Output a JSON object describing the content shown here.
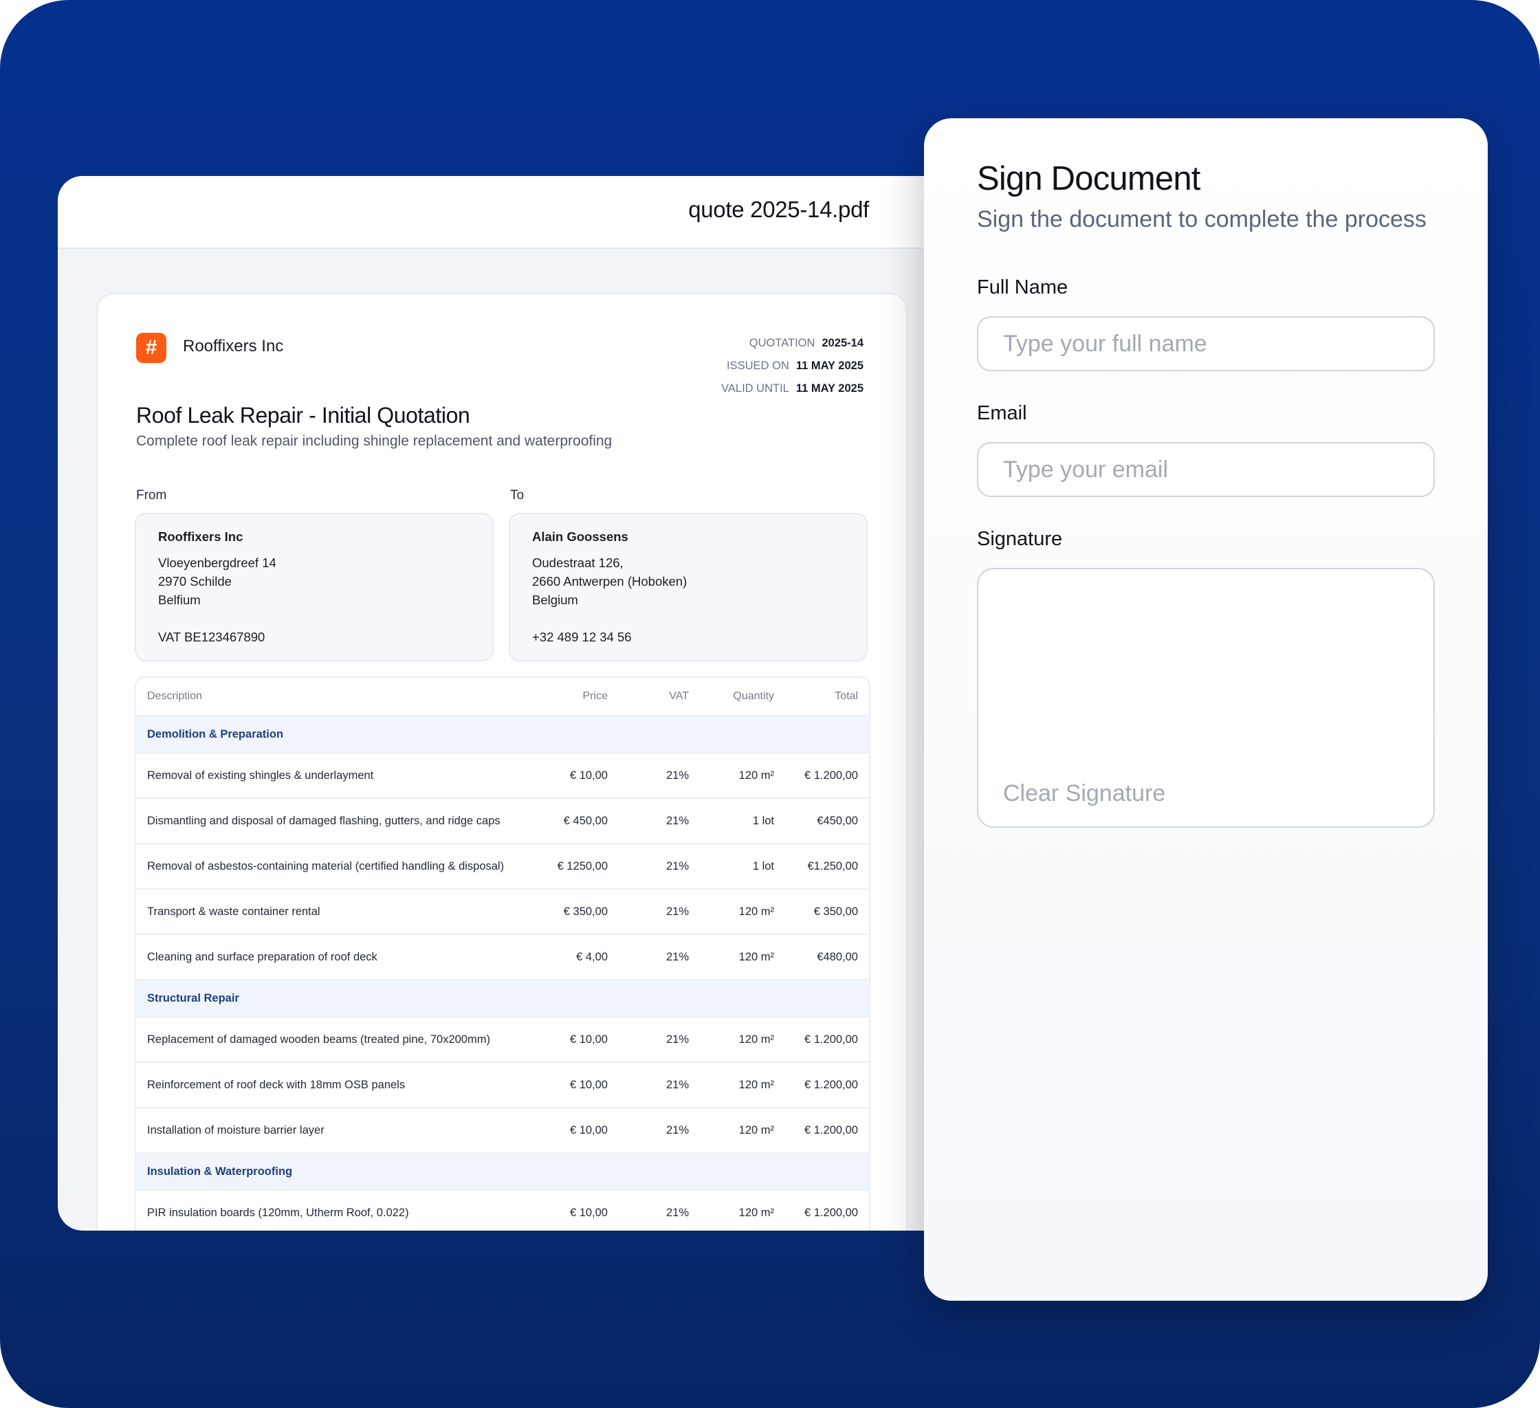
{
  "viewer": {
    "filename": "quote 2025-14.pdf"
  },
  "document": {
    "company": "Rooffixers Inc",
    "logo_glyph": "#",
    "meta": [
      {
        "label": "QUOTATION",
        "value": "2025-14"
      },
      {
        "label": "ISSUED ON",
        "value": "11 MAY 2025"
      },
      {
        "label": "VALID UNTIL",
        "value": "11 MAY 2025"
      }
    ],
    "title": "Roof Leak Repair - Initial Quotation",
    "subtitle": "Complete roof leak repair including shingle replacement and waterproofing",
    "from": {
      "label": "From",
      "name": "Rooffixers Inc",
      "line1": "Vloeyenbergdreef 14",
      "line2": "2970 Schilde",
      "line3": "Belfium",
      "extra": "VAT BE123467890"
    },
    "to": {
      "label": "To",
      "name": "Alain Goossens",
      "line1": "Oudestraat 126,",
      "line2": "2660 Antwerpen (Hoboken)",
      "line3": "Belgium",
      "extra": "+32 489 12 34 56"
    },
    "table": {
      "headers": {
        "description": "Description",
        "price": "Price",
        "vat": "VAT",
        "quantity": "Quantity",
        "total": "Total"
      },
      "sections": [
        {
          "title": "Demolition & Preparation",
          "rows": [
            {
              "description": "Removal of existing shingles & underlayment",
              "price": "€ 10,00",
              "vat": "21%",
              "quantity": "120 m²",
              "total": "€ 1.200,00"
            },
            {
              "description": "Dismantling and disposal of damaged flashing, gutters, and ridge caps",
              "price": "€ 450,00",
              "vat": "21%",
              "quantity": "1 lot",
              "total": "€450,00"
            },
            {
              "description": "Removal of asbestos-containing material (certified handling & disposal)",
              "price": "€ 1250,00",
              "vat": "21%",
              "quantity": "1 lot",
              "total": "€1.250,00"
            },
            {
              "description": "Transport & waste container rental",
              "price": "€ 350,00",
              "vat": "21%",
              "quantity": "120 m²",
              "total": "€ 350,00"
            },
            {
              "description": "Cleaning and surface preparation of roof deck",
              "price": "€ 4,00",
              "vat": "21%",
              "quantity": "120 m²",
              "total": "€480,00"
            }
          ]
        },
        {
          "title": "Structural Repair",
          "rows": [
            {
              "description": "Replacement of damaged wooden beams (treated pine, 70x200mm)",
              "price": "€ 10,00",
              "vat": "21%",
              "quantity": "120 m²",
              "total": "€ 1.200,00"
            },
            {
              "description": "Reinforcement of roof deck with 18mm OSB panels",
              "price": "€ 10,00",
              "vat": "21%",
              "quantity": "120 m²",
              "total": "€ 1.200,00"
            },
            {
              "description": "Installation of moisture barrier layer",
              "price": "€ 10,00",
              "vat": "21%",
              "quantity": "120 m²",
              "total": "€ 1.200,00"
            }
          ]
        },
        {
          "title": "Insulation & Waterproofing",
          "rows": [
            {
              "description": "PIR insulation boards (120mm, Utherm Roof,   0.022)",
              "price": "€ 10,00",
              "vat": "21%",
              "quantity": "120 m²",
              "total": "€ 1.200,00"
            }
          ]
        }
      ]
    }
  },
  "sign_panel": {
    "title": "Sign Document",
    "subtitle": "Sign the document to complete the process",
    "full_name": {
      "label": "Full Name",
      "placeholder": "Type your full name",
      "value": ""
    },
    "email": {
      "label": "Email",
      "placeholder": "Type your email",
      "value": ""
    },
    "signature": {
      "label": "Signature",
      "clear_label": "Clear Signature"
    }
  },
  "colors": {
    "background": "#0a2f7e",
    "brand": "#fb5b14",
    "section_text": "#1f3f7c"
  }
}
